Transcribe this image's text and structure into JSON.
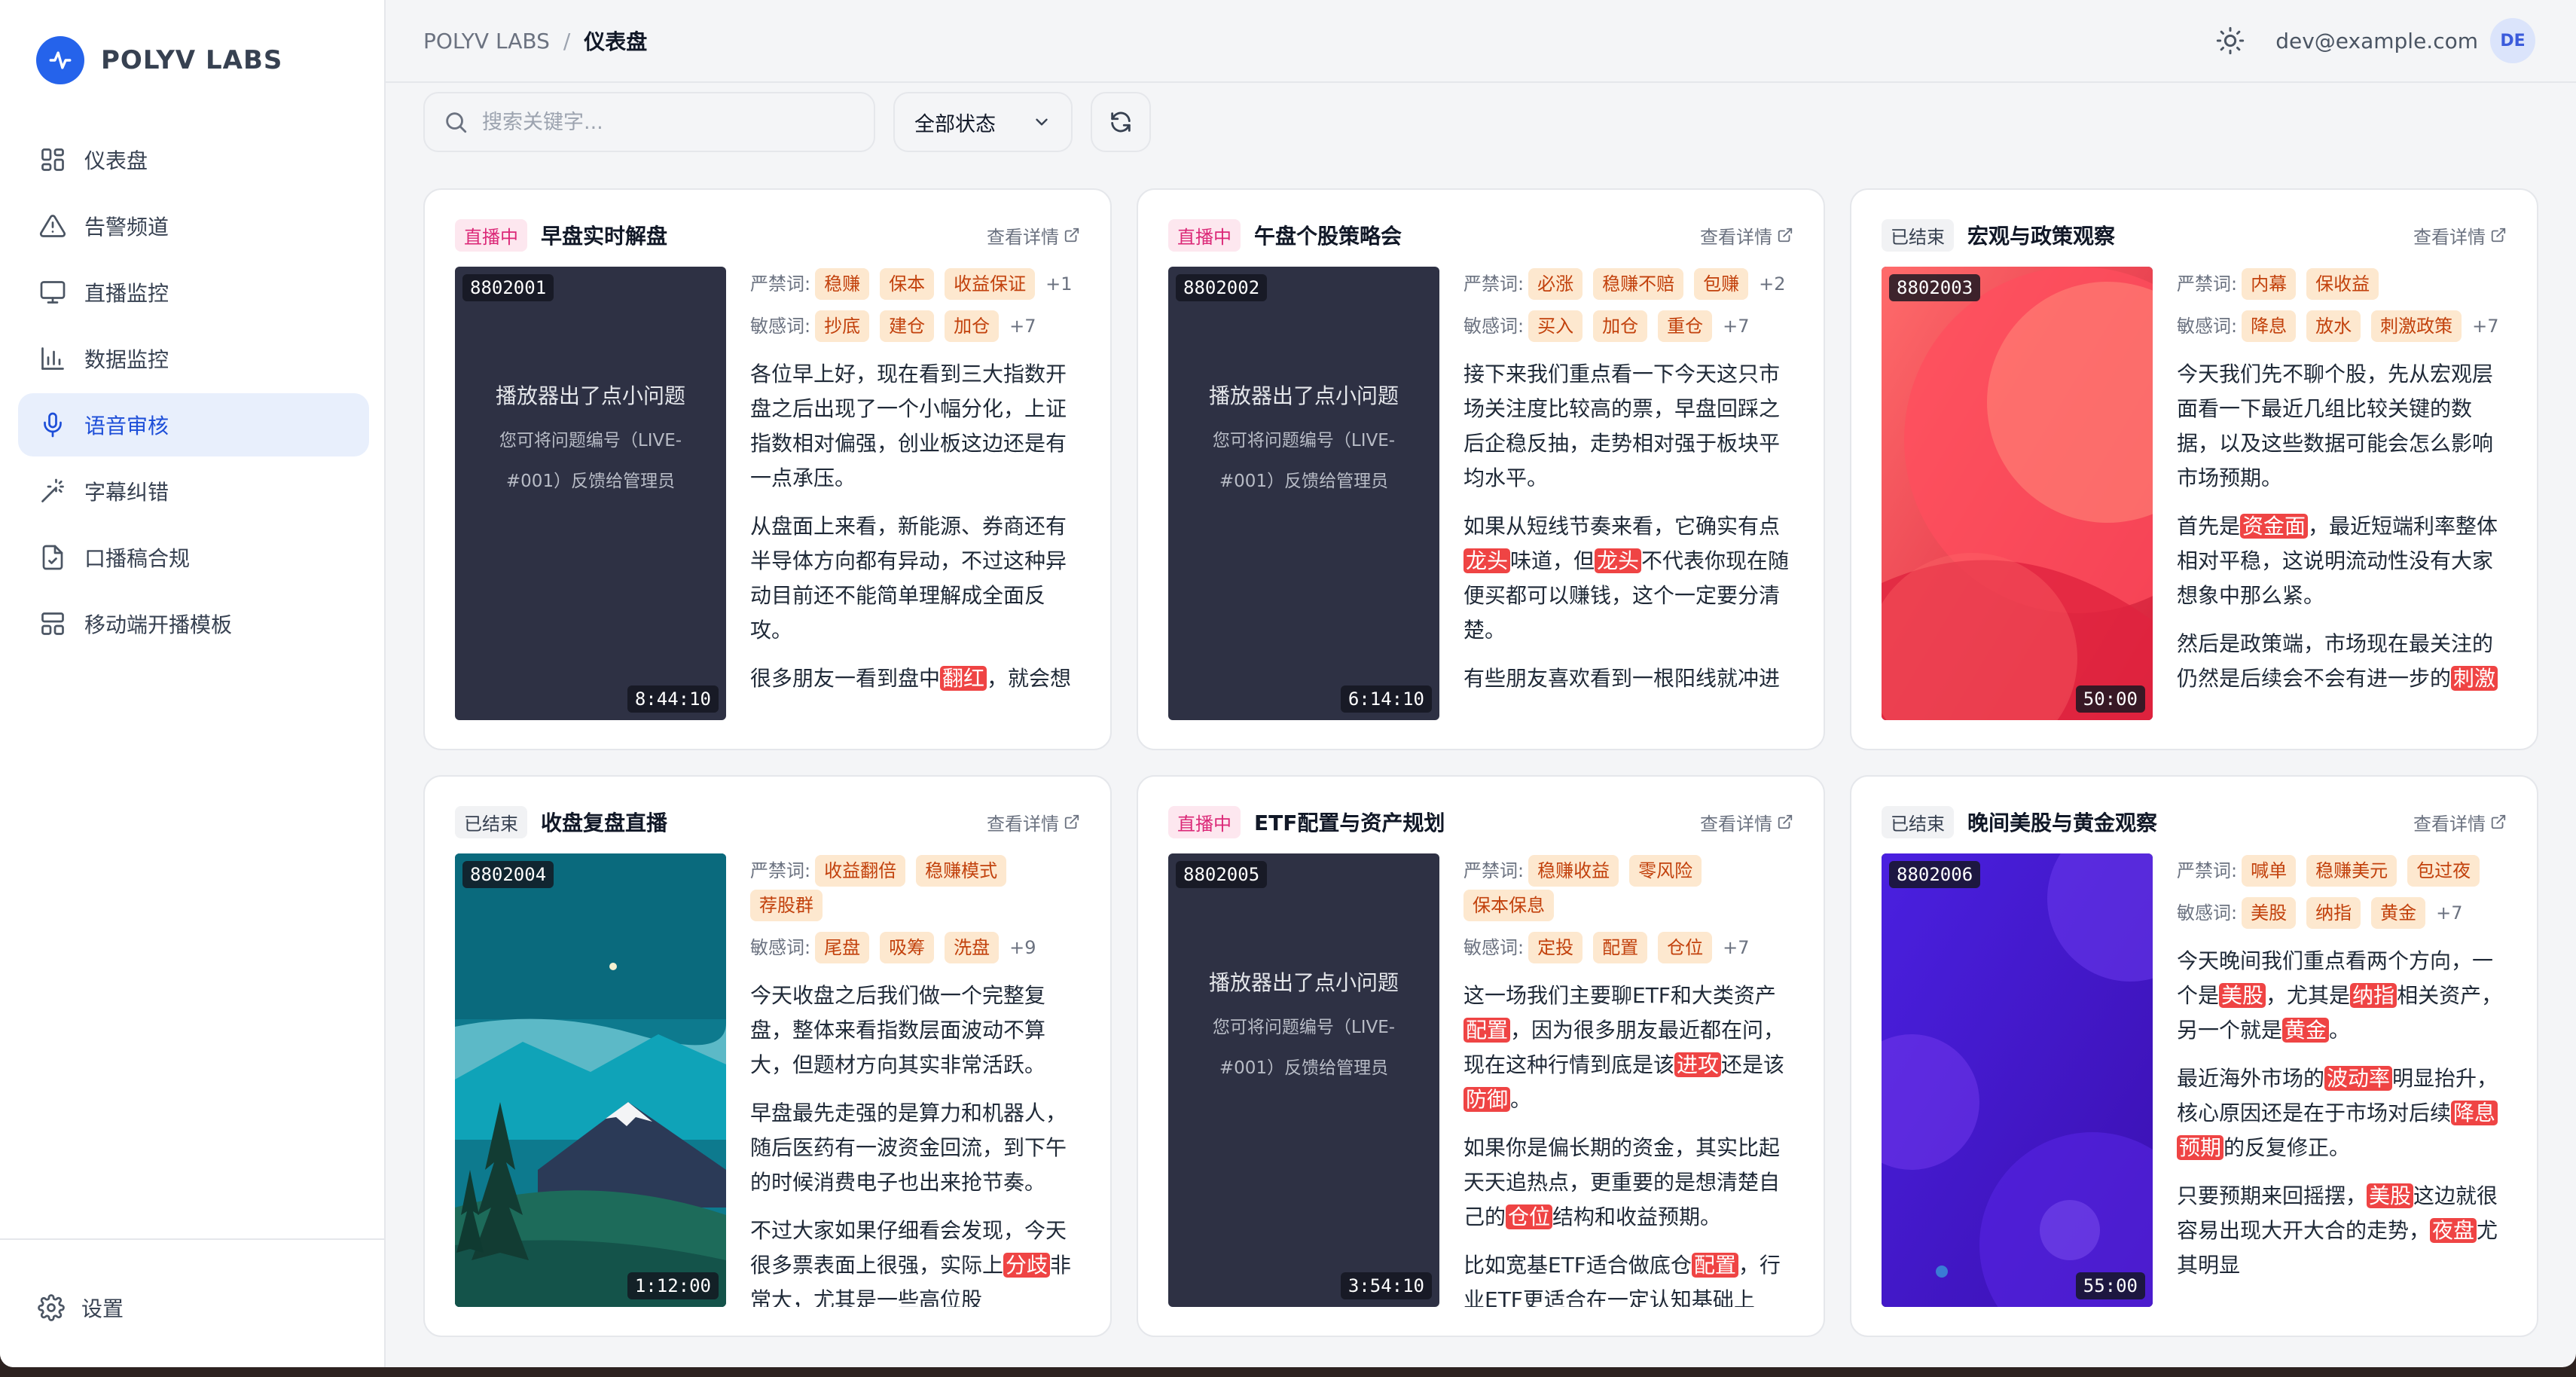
{
  "brand": {
    "name": "POLYV LABS"
  },
  "sidebar": {
    "items": [
      {
        "label": "仪表盘",
        "icon": "dashboard-icon",
        "active": false
      },
      {
        "label": "告警频道",
        "icon": "alert-triangle-icon",
        "active": false
      },
      {
        "label": "直播监控",
        "icon": "monitor-icon",
        "active": false
      },
      {
        "label": "数据监控",
        "icon": "bar-chart-icon",
        "active": false
      },
      {
        "label": "语音审核",
        "icon": "microphone-icon",
        "active": true
      },
      {
        "label": "字幕纠错",
        "icon": "magic-wand-icon",
        "active": false
      },
      {
        "label": "口播稿合规",
        "icon": "file-check-icon",
        "active": false
      },
      {
        "label": "移动端开播模板",
        "icon": "layout-icon",
        "active": false
      }
    ],
    "settings_label": "设置"
  },
  "breadcrumb": {
    "root": "POLYV LABS",
    "separator": "/",
    "current": "仪表盘"
  },
  "user": {
    "email": "dev@example.com",
    "initials": "DE"
  },
  "toolbar": {
    "search_placeholder": "搜索关键字...",
    "status_select": "全部状态"
  },
  "labels": {
    "banned": "严禁词:",
    "sensitive": "敏感词:",
    "detail": "查看详情"
  },
  "player_error": {
    "title": "播放器出了点小问题",
    "line1": "您可将问题编号（LIVE-",
    "line2": "#001）反馈给管理员"
  },
  "cards": [
    {
      "status": "直播中",
      "status_type": "live",
      "title": "早盘实时解盘",
      "id": "8802001",
      "duration": "8:44:10",
      "thumb": "error",
      "banned": [
        "稳赚",
        "保本",
        "收益保证"
      ],
      "banned_more": "+1",
      "sensitive": [
        "抄底",
        "建仓",
        "加仓"
      ],
      "sensitive_more": "+7",
      "paragraphs": [
        [
          {
            "t": "各位早上好，现在看到三大指数开盘之后出现了一个小幅分化，上证指数相对偏强，创业板这边还是有一点承压。"
          }
        ],
        [
          {
            "t": "从盘面上来看，新能源、券商还有半导体方向都有异动，不过这种异动目前还不能简单理解成全面反攻。"
          }
        ],
        [
          {
            "t": "很多朋友一看到盘中"
          },
          {
            "t": "翻红",
            "h": true
          },
          {
            "t": "，就会想"
          }
        ]
      ]
    },
    {
      "status": "直播中",
      "status_type": "live",
      "title": "午盘个股策略会",
      "id": "8802002",
      "duration": "6:14:10",
      "thumb": "error",
      "banned": [
        "必涨",
        "稳赚不赔",
        "包赚"
      ],
      "banned_more": "+2",
      "sensitive": [
        "买入",
        "加仓",
        "重仓"
      ],
      "sensitive_more": "+7",
      "paragraphs": [
        [
          {
            "t": "接下来我们重点看一下今天这只市场关注度比较高的票，早盘回踩之后企稳反抽，走势相对强于板块平均水平。"
          }
        ],
        [
          {
            "t": "如果从短线节奏来看，它确实有点"
          },
          {
            "t": "龙头",
            "h": true
          },
          {
            "t": "味道，但"
          },
          {
            "t": "龙头",
            "h": true
          },
          {
            "t": "不代表你现在随便买都可以赚钱，这个一定要分清楚。"
          }
        ],
        [
          {
            "t": "有些朋友喜欢看到一根阳线就冲进"
          }
        ]
      ]
    },
    {
      "status": "已结束",
      "status_type": "end",
      "title": "宏观与政策观察",
      "id": "8802003",
      "duration": "50:00",
      "thumb": "red",
      "banned": [
        "内幕",
        "保收益"
      ],
      "banned_more": "",
      "sensitive": [
        "降息",
        "放水",
        "刺激政策"
      ],
      "sensitive_more": "+7",
      "paragraphs": [
        [
          {
            "t": "今天我们先不聊个股，先从宏观层面看一下最近几组比较关键的数据，以及这些数据可能会怎么影响市场预期。"
          }
        ],
        [
          {
            "t": "首先是"
          },
          {
            "t": "资金面",
            "h": true
          },
          {
            "t": "，最近短端利率整体相对平稳，这说明流动性没有大家想象中那么紧。"
          }
        ],
        [
          {
            "t": "然后是政策端，市场现在最关注的仍然是后续会不会有进一步的"
          },
          {
            "t": "刺激",
            "h": true
          }
        ]
      ]
    },
    {
      "status": "已结束",
      "status_type": "end",
      "title": "收盘复盘直播",
      "id": "8802004",
      "duration": "1:12:00",
      "thumb": "mountain",
      "banned": [
        "收益翻倍",
        "稳赚模式",
        "荐股群"
      ],
      "banned_more": "",
      "sensitive": [
        "尾盘",
        "吸筹",
        "洗盘"
      ],
      "sensitive_more": "+9",
      "paragraphs": [
        [
          {
            "t": "今天收盘之后我们做一个完整复盘，整体来看指数层面波动不算大，但题材方向其实非常活跃。"
          }
        ],
        [
          {
            "t": "早盘最先走强的是算力和机器人，随后医药有一波资金回流，到下午的时候消费电子也出来抢节奏。"
          }
        ],
        [
          {
            "t": "不过大家如果仔细看会发现，今天很多票表面上很强，实际上"
          },
          {
            "t": "分歧",
            "h": true
          },
          {
            "t": "非常大，尤其是一些高位股"
          }
        ]
      ]
    },
    {
      "status": "直播中",
      "status_type": "live",
      "title": "ETF配置与资产规划",
      "id": "8802005",
      "duration": "3:54:10",
      "thumb": "error",
      "banned": [
        "稳赚收益",
        "零风险",
        "保本保息"
      ],
      "banned_more": "",
      "sensitive": [
        "定投",
        "配置",
        "仓位"
      ],
      "sensitive_more": "+7",
      "paragraphs": [
        [
          {
            "t": "这一场我们主要聊ETF和大类资产"
          },
          {
            "t": "配置",
            "h": true
          },
          {
            "t": "，因为很多朋友最近都在问，现在这种行情到底是该"
          },
          {
            "t": "进攻",
            "h": true
          },
          {
            "t": "还是该"
          },
          {
            "t": "防御",
            "h": true
          },
          {
            "t": "。"
          }
        ],
        [
          {
            "t": "如果你是偏长期的资金，其实比起天天追热点，更重要的是想清楚自己的"
          },
          {
            "t": "仓位",
            "h": true
          },
          {
            "t": "结构和收益预期。"
          }
        ],
        [
          {
            "t": "比如宽基ETF适合做底仓"
          },
          {
            "t": "配置",
            "h": true
          },
          {
            "t": "，行业ETF更适合在一定认知基础上"
          }
        ]
      ]
    },
    {
      "status": "已结束",
      "status_type": "end",
      "title": "晚间美股与黄金观察",
      "id": "8802006",
      "duration": "55:00",
      "thumb": "purple",
      "banned": [
        "喊单",
        "稳赚美元",
        "包过夜"
      ],
      "banned_more": "",
      "sensitive": [
        "美股",
        "纳指",
        "黄金"
      ],
      "sensitive_more": "+7",
      "paragraphs": [
        [
          {
            "t": "今天晚间我们重点看两个方向，一个是"
          },
          {
            "t": "美股",
            "h": true
          },
          {
            "t": "，尤其是"
          },
          {
            "t": "纳指",
            "h": true
          },
          {
            "t": "相关资产，另一个就是"
          },
          {
            "t": "黄金",
            "h": true
          },
          {
            "t": "。"
          }
        ],
        [
          {
            "t": "最近海外市场的"
          },
          {
            "t": "波动率",
            "h": true
          },
          {
            "t": "明显抬升，核心原因还是在于市场对后续"
          },
          {
            "t": "降息",
            "h": true
          },
          {
            "t": ""
          },
          {
            "t": "预期",
            "h": true
          },
          {
            "t": "的反复修正。"
          }
        ],
        [
          {
            "t": "只要预期来回摇摆，"
          },
          {
            "t": "美股",
            "h": true
          },
          {
            "t": "这边就很容易出现大开大合的走势，"
          },
          {
            "t": "夜盘",
            "h": true
          },
          {
            "t": "尤其明显"
          }
        ]
      ]
    }
  ]
}
